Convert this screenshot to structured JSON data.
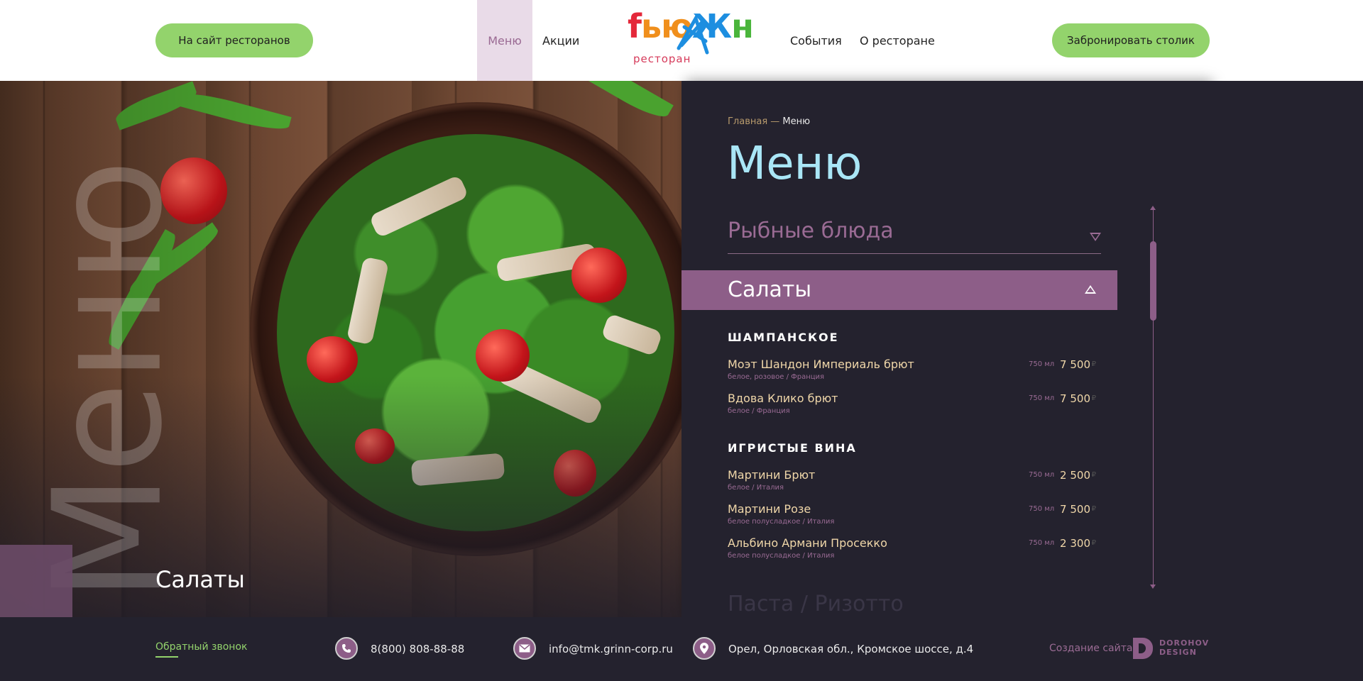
{
  "header": {
    "restaurants_button": "На сайт ресторанов",
    "nav": [
      "Меню",
      "Акции",
      "События",
      "О ресторане"
    ],
    "book_button": "Забронировать столик",
    "logo_word": [
      "f",
      "ью",
      "Ж",
      "н"
    ],
    "logo_sub": "ресторан"
  },
  "hero": {
    "vertical_word": "Меню",
    "caption": "Салаты"
  },
  "menu": {
    "breadcrumb_home": "Главная",
    "breadcrumb_sep": " — ",
    "breadcrumb_current": "Меню",
    "title": "Меню",
    "category_collapsed": "Рыбные блюда",
    "category_open": "Салаты",
    "category_next": "Паста / Ризотто",
    "sections": [
      {
        "title": "ШАМПАНСКОЕ",
        "items": [
          {
            "name": "Моэт Шандон Империаль брют",
            "desc": "белое, розовое / Франция",
            "volume": "750 мл",
            "price": "7 500"
          },
          {
            "name": "Вдова Клико брют",
            "desc": "белое / Франция",
            "volume": "750 мл",
            "price": "7 500"
          }
        ]
      },
      {
        "title": "ИГРИСТЫЕ ВИНА",
        "items": [
          {
            "name": "Мартини Брют",
            "desc": "белое / Италия",
            "volume": "750 мл",
            "price": "2 500"
          },
          {
            "name": "Мартини Розе",
            "desc": "белое полусладкое / Италия",
            "volume": "750 мл",
            "price": "7 500"
          },
          {
            "name": "Альбино Армани Просекко",
            "desc": "белое полусладкое / Италия",
            "volume": "750 мл",
            "price": "2 300"
          }
        ]
      }
    ],
    "currency": "₽"
  },
  "footer": {
    "callback": "Обратный звонок",
    "phone": "8(800) 808-88-88",
    "email": "info@tmk.grinn-corp.ru",
    "address": "Орел, Орловская обл., Кромское шоссе, д.4",
    "credit": "Создание сайта -",
    "credit_name_1": "DOROHOV",
    "credit_name_2": "DESIGN"
  },
  "colors": {
    "accent_green": "#93d36c",
    "accent_purple": "#8d5e88",
    "panel_bg": "#24222e",
    "title_cyan": "#a9e6f6",
    "item_gold": "#f0d7a9"
  },
  "icons": [
    "phone-icon",
    "mail-icon",
    "location-icon",
    "expand-icon",
    "collapse-icon"
  ]
}
